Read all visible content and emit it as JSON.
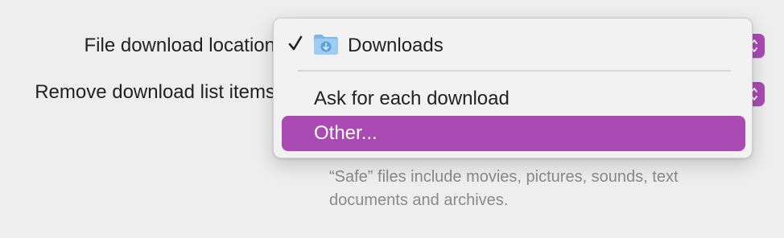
{
  "settings": {
    "download_location_label": "File download location",
    "remove_items_label": "Remove download list items"
  },
  "menu": {
    "items": [
      {
        "label": "Downloads",
        "checked": true,
        "icon": "downloads-folder-icon"
      },
      {
        "label": "Ask for each download",
        "checked": false
      },
      {
        "label": "Other...",
        "checked": false,
        "highlighted": true
      }
    ]
  },
  "footnote": "“Safe” files include movies, pictures, sounds, text documents and archives.",
  "colors": {
    "accent": "#a94bb3",
    "background": "#efeeee",
    "menu_background": "#f3f2f2",
    "muted_text": "#8a8a8a"
  }
}
